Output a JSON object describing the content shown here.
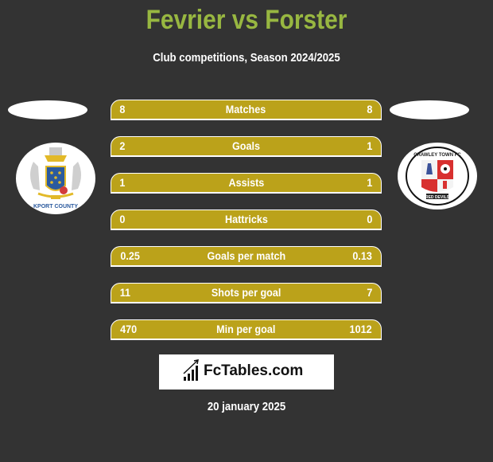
{
  "header": {
    "title": "Fevrier vs Forster",
    "subtitle": "Club competitions, Season 2024/2025"
  },
  "teams": {
    "left": {
      "logo": "stockport-county-crest",
      "logo_text": "STOCKPORT COUNTY"
    },
    "right": {
      "logo": "crawley-town-crest",
      "logo_text": "CRAWLEY TOWN FC",
      "logo_subtext": "RED DEVILS"
    }
  },
  "colors": {
    "title": "#98b741",
    "bar": "#bba21a",
    "background": "#333333"
  },
  "stats": [
    {
      "label": "Matches",
      "left": "8",
      "right": "8"
    },
    {
      "label": "Goals",
      "left": "2",
      "right": "1"
    },
    {
      "label": "Assists",
      "left": "1",
      "right": "1"
    },
    {
      "label": "Hattricks",
      "left": "0",
      "right": "0"
    },
    {
      "label": "Goals per match",
      "left": "0.25",
      "right": "0.13"
    },
    {
      "label": "Shots per goal",
      "left": "11",
      "right": "7"
    },
    {
      "label": "Min per goal",
      "left": "470",
      "right": "1012"
    }
  ],
  "footer": {
    "brand": "FcTables.com",
    "brand_icon": "bar-chart-icon",
    "date": "20 january 2025"
  }
}
